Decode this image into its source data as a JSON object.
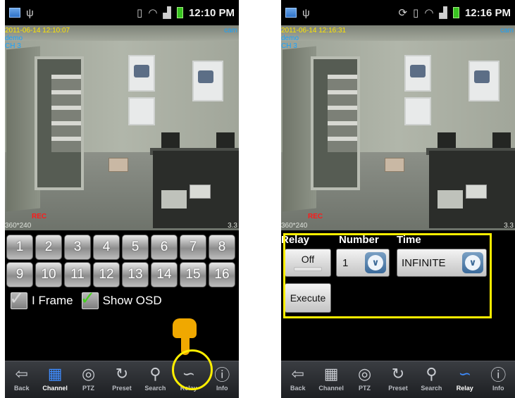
{
  "left_screen": {
    "status_bar": {
      "time": "12:10 PM"
    },
    "osd": {
      "date": "2011-06-14 12:10:07",
      "user": "demo",
      "channel": "CH 3",
      "rec": "REC",
      "resolution": "360*240",
      "fps": "3.3",
      "corner": "cam"
    },
    "channel_buttons": [
      "1",
      "2",
      "3",
      "4",
      "5",
      "6",
      "7",
      "8",
      "9",
      "10",
      "11",
      "12",
      "13",
      "14",
      "15",
      "16"
    ],
    "options": [
      {
        "label": "I Frame",
        "checked": false
      },
      {
        "label": "Show OSD",
        "checked": true
      }
    ]
  },
  "right_screen": {
    "status_bar": {
      "time": "12:16 PM"
    },
    "osd": {
      "date": "2011-06-14 12:16:31",
      "user": "demo",
      "channel": "CH 3",
      "rec": "REC",
      "resolution": "360*240",
      "fps": "3.3",
      "corner": "cam"
    },
    "relay_panel": {
      "relay_header": "Relay",
      "number_header": "Number",
      "time_header": "Time",
      "toggle_label": "Off",
      "number_value": "1",
      "time_value": "INFINITE",
      "execute_label": "Execute"
    }
  },
  "bottom_nav": {
    "items": [
      {
        "label": "Back",
        "icon": "back-arrow-icon"
      },
      {
        "label": "Channel",
        "icon": "grid-icon"
      },
      {
        "label": "PTZ",
        "icon": "ptz-icon"
      },
      {
        "label": "Preset",
        "icon": "preset-icon"
      },
      {
        "label": "Search",
        "icon": "search-icon"
      },
      {
        "label": "Relay",
        "icon": "relay-icon"
      },
      {
        "label": "Info",
        "icon": "info-icon"
      }
    ],
    "left_active": "Channel",
    "right_active": "Relay"
  },
  "colors": {
    "highlight": "#ffef00",
    "osd_date": "#ffe600",
    "osd_text": "#16a3ff",
    "rec": "#ff1a1a",
    "active_nav": "#3e8cff"
  }
}
